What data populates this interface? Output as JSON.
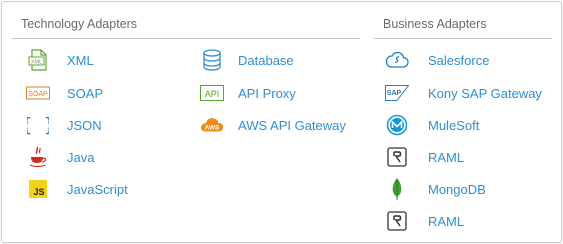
{
  "technology": {
    "title": "Technology Adapters",
    "col1": [
      {
        "label": "XML",
        "icon": "xml-icon"
      },
      {
        "label": "SOAP",
        "icon": "soap-icon"
      },
      {
        "label": "JSON",
        "icon": "json-braces-icon"
      },
      {
        "label": "Java",
        "icon": "java-cup-icon"
      },
      {
        "label": "JavaScript",
        "icon": "javascript-icon"
      }
    ],
    "col2": [
      {
        "label": "Database",
        "icon": "database-icon"
      },
      {
        "label": "API Proxy",
        "icon": "api-icon"
      },
      {
        "label": "AWS API Gateway",
        "icon": "aws-icon"
      }
    ]
  },
  "business": {
    "title": "Business Adapters",
    "items": [
      {
        "label": "Salesforce",
        "icon": "salesforce-cloud-icon"
      },
      {
        "label": "Kony SAP Gateway",
        "icon": "sap-icon"
      },
      {
        "label": "MuleSoft",
        "icon": "mulesoft-icon"
      },
      {
        "label": "RAML",
        "icon": "raml-icon"
      },
      {
        "label": "MongoDB",
        "icon": "mongodb-leaf-icon"
      },
      {
        "label": "RAML",
        "icon": "raml-icon"
      }
    ]
  },
  "icon_text": {
    "xml": "XML",
    "soap": "SOAP",
    "json": "{ }",
    "js": "JS",
    "api": "API",
    "aws": "AWS",
    "sap": "SAP"
  },
  "colors": {
    "label": "#2f8fd0",
    "heading": "#666c72",
    "xml_green": "#5aa832",
    "soap_orange": "#e07b14",
    "json_blue": "#2a7ab8",
    "java_red": "#d12b1f",
    "js_yellow": "#f2d21b",
    "db_blue": "#2f8fd0",
    "aws_orange": "#f08a1c",
    "mule_blue": "#1497d4",
    "mongo_green": "#3fa037"
  }
}
